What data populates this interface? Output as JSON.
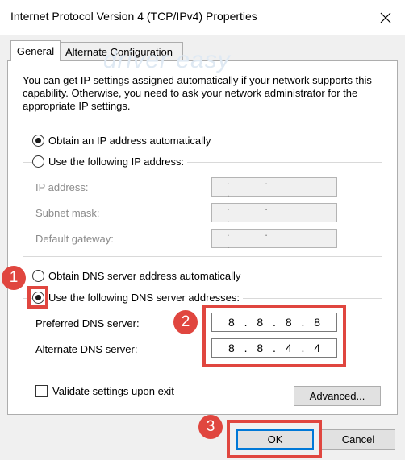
{
  "window": {
    "title": "Internet Protocol Version 4 (TCP/IPv4) Properties",
    "close_glyph": "✕"
  },
  "tabs": [
    {
      "label": "General",
      "selected": true
    },
    {
      "label": "Alternate Configuration",
      "selected": false
    }
  ],
  "watermark": "driver easy",
  "description": "You can get IP settings assigned automatically if your network supports this capability. Otherwise, you need to ask your network administrator for the appropriate IP settings.",
  "ip_section": {
    "auto_label": "Obtain an IP address automatically",
    "auto_selected": true,
    "manual_label": "Use the following IP address:",
    "manual_selected": false,
    "fields": [
      {
        "label": "IP address:",
        "value": ". . ."
      },
      {
        "label": "Subnet mask:",
        "value": ". . ."
      },
      {
        "label": "Default gateway:",
        "value": ". . ."
      }
    ]
  },
  "dns_section": {
    "auto_label": "Obtain DNS server address automatically",
    "auto_selected": false,
    "manual_label": "Use the following DNS server addresses:",
    "manual_selected": true,
    "preferred_label": "Preferred DNS server:",
    "preferred_octets": [
      "8",
      "8",
      "8",
      "8"
    ],
    "alternate_label": "Alternate DNS server:",
    "alternate_octets": [
      "8",
      "8",
      "4",
      "4"
    ]
  },
  "validate": {
    "label": "Validate settings upon exit",
    "checked": false
  },
  "buttons": {
    "advanced": "Advanced...",
    "ok": "OK",
    "cancel": "Cancel"
  },
  "annotations": [
    "1",
    "2",
    "3"
  ],
  "colors": {
    "highlight": "#e0463f",
    "ok_focus": "#0078d7"
  }
}
